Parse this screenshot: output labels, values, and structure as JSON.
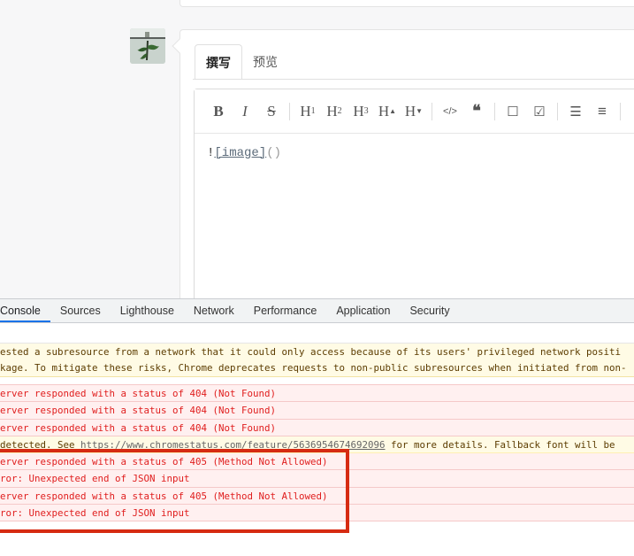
{
  "editor": {
    "tabs": [
      {
        "label": "撰写",
        "active": true
      },
      {
        "label": "预览",
        "active": false
      }
    ],
    "toolbar": [
      {
        "icon": "bold-icon",
        "glyph": "B"
      },
      {
        "icon": "italic-icon",
        "glyph": "I"
      },
      {
        "icon": "strikethrough-icon",
        "glyph": "S"
      },
      {
        "icon": "heading-1-icon",
        "glyph": "H",
        "sub": "1"
      },
      {
        "icon": "heading-2-icon",
        "glyph": "H",
        "sub": "2"
      },
      {
        "icon": "heading-3-icon",
        "glyph": "H",
        "sub": "3"
      },
      {
        "icon": "heading-increase-icon",
        "glyph": "H",
        "sub": "▲"
      },
      {
        "icon": "heading-decrease-icon",
        "glyph": "H",
        "sub": "▼"
      },
      {
        "icon": "code-icon",
        "glyph": "</>"
      },
      {
        "icon": "quote-icon",
        "glyph": "❝"
      },
      {
        "icon": "checkbox-empty-icon",
        "glyph": "☐"
      },
      {
        "icon": "checkbox-checked-icon",
        "glyph": "☑"
      },
      {
        "icon": "bullet-list-icon",
        "glyph": "☰"
      },
      {
        "icon": "numbered-list-icon",
        "glyph": "≡"
      }
    ],
    "content": {
      "bang": "!",
      "link_text": "[image]",
      "parens": "()"
    }
  },
  "devtools": {
    "tabs": [
      "Console",
      "Sources",
      "Lighthouse",
      "Network",
      "Performance",
      "Application",
      "Security"
    ],
    "active_tab": "Console",
    "messages": [
      {
        "type": "warn-block",
        "lines": [
          "ested a subresource from a network that it could only access because of its users' privileged network positi",
          "kage. To mitigate these risks, Chrome deprecates requests to non-public subresources when initiated from non-"
        ]
      },
      {
        "type": "error",
        "text": "erver responded with a status of 404 (Not Found)"
      },
      {
        "type": "error",
        "text": "erver responded with a status of 404 (Not Found)"
      },
      {
        "type": "error",
        "text": "erver responded with a status of 404 (Not Found)"
      },
      {
        "type": "warn",
        "prefix": " detected. See ",
        "link": "https://www.chromestatus.com/feature/5636954674692096",
        "suffix": " for more details. Fallback font will be"
      },
      {
        "type": "error",
        "text": "erver responded with a status of 405 (Method Not Allowed)"
      },
      {
        "type": "error",
        "text": "ror: Unexpected end of JSON input"
      },
      {
        "type": "error",
        "text": "erver responded with a status of 405 (Method Not Allowed)"
      },
      {
        "type": "error",
        "text": "ror: Unexpected end of JSON input"
      }
    ]
  },
  "colors": {
    "highlight_box": "#d62b12",
    "error_text": "#e01e1e",
    "error_bg": "#fff0f0",
    "warn_bg": "#fffbe5",
    "active_tab_underline": "#1a73e8"
  }
}
